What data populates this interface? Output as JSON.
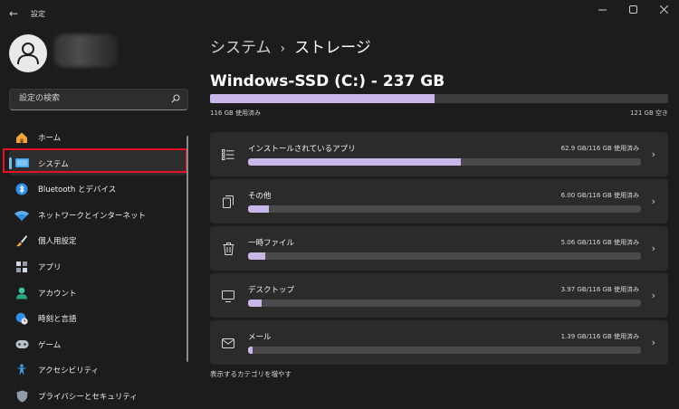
{
  "window": {
    "title": "設定"
  },
  "user": {
    "name": ""
  },
  "search": {
    "placeholder": "設定の検索",
    "value": ""
  },
  "nav": {
    "items": [
      {
        "label": "ホーム",
        "icon": "home-icon"
      },
      {
        "label": "システム",
        "icon": "display-icon",
        "selected": true
      },
      {
        "label": "Bluetooth とデバイス",
        "icon": "bluetooth-icon"
      },
      {
        "label": "ネットワークとインターネット",
        "icon": "wifi-icon"
      },
      {
        "label": "個人用設定",
        "icon": "brush-icon"
      },
      {
        "label": "アプリ",
        "icon": "apps-icon"
      },
      {
        "label": "アカウント",
        "icon": "account-icon"
      },
      {
        "label": "時刻と言語",
        "icon": "globe-clock-icon"
      },
      {
        "label": "ゲーム",
        "icon": "gamepad-icon"
      },
      {
        "label": "アクセシビリティ",
        "icon": "accessibility-icon"
      },
      {
        "label": "プライバシーとセキュリティ",
        "icon": "shield-icon"
      }
    ]
  },
  "breadcrumb": {
    "parent": "システム",
    "separator": "›",
    "current": "ストレージ"
  },
  "drive": {
    "title": "Windows-SSD (C:) - 237 GB",
    "used_label": "116 GB 使用済み",
    "free_label": "121 GB 空き",
    "used_fraction": 0.49
  },
  "categories": [
    {
      "name": "インストールされているアプリ",
      "usage": "62.9 GB/116 GB 使用済み",
      "fraction": 0.542,
      "icon": "apps-list-icon"
    },
    {
      "name": "その他",
      "usage": "6.00 GB/116 GB 使用済み",
      "fraction": 0.052,
      "icon": "copy-icon"
    },
    {
      "name": "一時ファイル",
      "usage": "5.06 GB/116 GB 使用済み",
      "fraction": 0.044,
      "icon": "trash-icon"
    },
    {
      "name": "デスクトップ",
      "usage": "3.97 GB/116 GB 使用済み",
      "fraction": 0.034,
      "icon": "monitor-icon"
    },
    {
      "name": "メール",
      "usage": "1.39 GB/116 GB 使用済み",
      "fraction": 0.012,
      "icon": "mail-icon"
    }
  ],
  "show_more": "表示するカテゴリを増やす",
  "colors": {
    "accent": "#76b9ed",
    "bar_fill": "#c9b7ea",
    "highlight_box": "#e81123"
  }
}
